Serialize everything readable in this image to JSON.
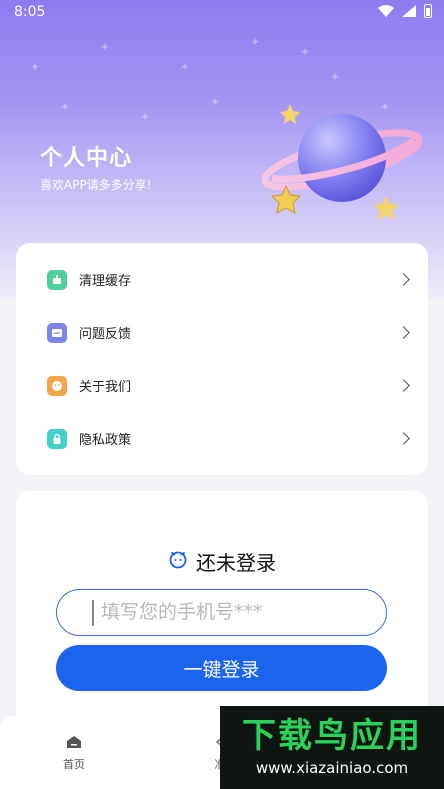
{
  "status_bar": {
    "time": "8:05"
  },
  "header": {
    "title": "个人中心",
    "subtitle": "喜欢APP请多多分享!"
  },
  "menu": {
    "items": [
      {
        "label": "清理缓存",
        "icon": "broom-icon",
        "color": "#4fcf9a"
      },
      {
        "label": "问题反馈",
        "icon": "feedback-icon",
        "color": "#7b87e8"
      },
      {
        "label": "关于我们",
        "icon": "smile-icon",
        "color": "#f4a54a"
      },
      {
        "label": "隐私政策",
        "icon": "lock-icon",
        "color": "#41d1c7"
      }
    ]
  },
  "login": {
    "title": "还未登录",
    "phone_placeholder": "填写您的手机号***",
    "button_label": "一键登录"
  },
  "tabs": [
    {
      "label": "首页"
    },
    {
      "label": "准"
    }
  ],
  "watermark": {
    "text": "下载鸟应用",
    "url": "www.xiazainiao.com"
  },
  "colors": {
    "accent": "#1a64f0",
    "hero_top": "#8e7cf0",
    "watermark_green": "#2bd25a"
  }
}
